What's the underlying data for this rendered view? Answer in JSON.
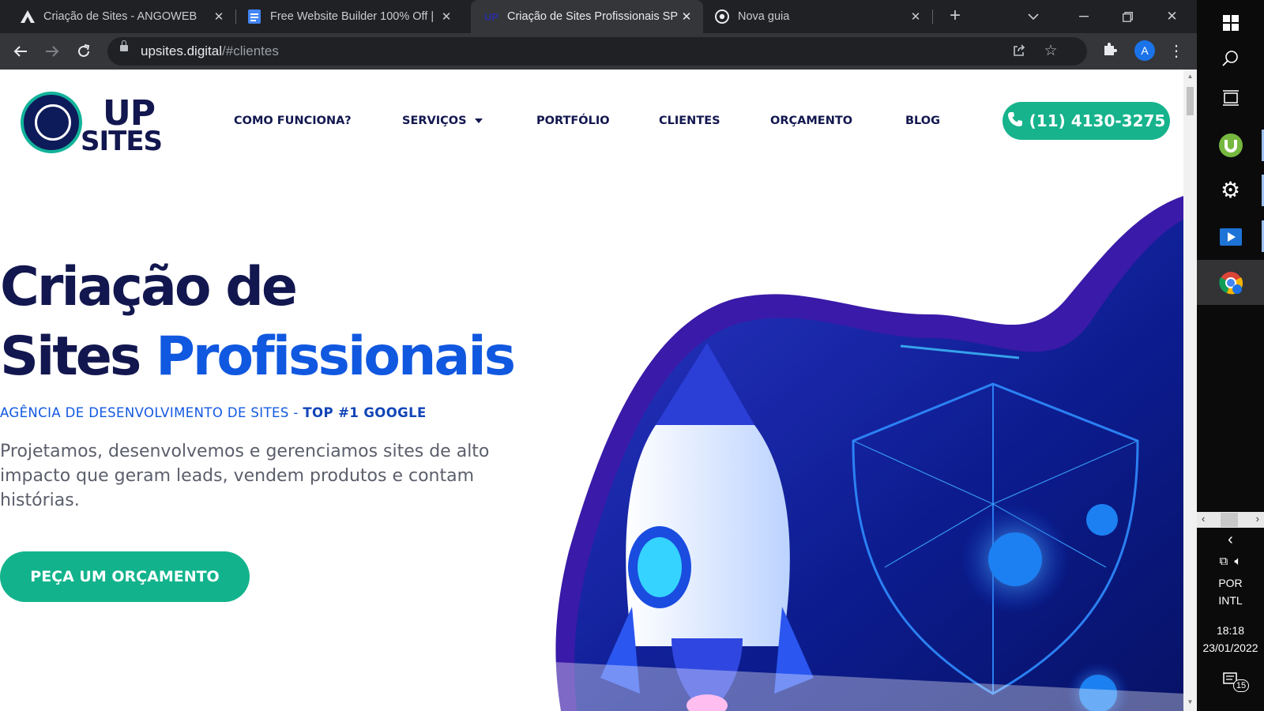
{
  "browser": {
    "tabs": [
      {
        "title": "Criação de Sites - ANGOWEB",
        "favicon": "angoweb-logo-icon",
        "active": false
      },
      {
        "title": "Free Website Builder 100% Off |",
        "favicon": "document-icon",
        "active": false
      },
      {
        "title": "Criação de Sites Profissionais SP",
        "favicon": "up-logo-icon",
        "active": true
      },
      {
        "title": "Nova guia",
        "favicon": "chrome-icon",
        "active": false
      }
    ],
    "favicon_text_up": "UP",
    "url_domain": "upsites.digital",
    "url_path": "/#clientes",
    "profile_initial": "A"
  },
  "site": {
    "logo": {
      "line1": "UP",
      "line2": "SITES"
    },
    "menu": [
      {
        "label": "COMO FUNCIONA?",
        "dropdown": false
      },
      {
        "label": "SERVIÇOS",
        "dropdown": true
      },
      {
        "label": "PORTFÓLIO",
        "dropdown": false
      },
      {
        "label": "CLIENTES",
        "dropdown": false
      },
      {
        "label": "ORÇAMENTO",
        "dropdown": false
      },
      {
        "label": "BLOG",
        "dropdown": false
      }
    ],
    "phone": "(11) 4130-3275",
    "hero": {
      "title_line1": "Criação de",
      "title_line2_dark": "Sites ",
      "title_line2_highlight": "Profissionais",
      "tagline_main": "AGÊNCIA DE DESENVOLVIMENTO DE SITES - ",
      "tagline_bold": "TOP #1 GOOGLE",
      "description": "Projetamos, desenvolvemos e gerenciamos sites de alto impacto que geram leads, vendem produtos e contam histórias.",
      "cta": "PEÇA UM ORÇAMENTO"
    },
    "colors": {
      "navy": "#12174f",
      "blue": "#1158e0",
      "green": "#16b38c"
    }
  },
  "taskbar": {
    "language": "POR",
    "layout": "INTL",
    "time": "18:18",
    "date": "23/01/2022",
    "notifications": "15"
  }
}
